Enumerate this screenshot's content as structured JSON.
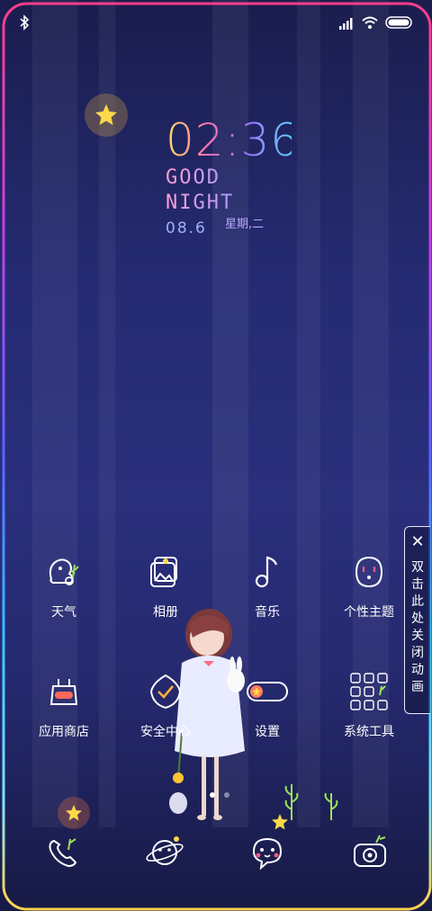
{
  "status": {
    "bluetooth_icon": "bluetooth-icon",
    "signal_icon": "signal-icon",
    "wifi_icon": "wifi-icon",
    "battery_icon": "battery-icon"
  },
  "clock": {
    "time": "02:36",
    "greeting": "GOOD NIGHT",
    "date": "08.6",
    "weekday": "星期,二"
  },
  "apps": [
    {
      "label": "天气",
      "icon": "weather-icon"
    },
    {
      "label": "相册",
      "icon": "gallery-icon"
    },
    {
      "label": "音乐",
      "icon": "music-icon"
    },
    {
      "label": "个性主题",
      "icon": "themes-icon"
    },
    {
      "label": "应用商店",
      "icon": "app-store-icon"
    },
    {
      "label": "安全中心",
      "icon": "security-icon"
    },
    {
      "label": "设置",
      "icon": "settings-toggle-icon"
    },
    {
      "label": "系统工具",
      "icon": "system-tools-icon"
    }
  ],
  "pager": {
    "pages": 2,
    "current": 1
  },
  "dock": [
    {
      "icon": "phone-icon"
    },
    {
      "icon": "planet-browser-icon"
    },
    {
      "icon": "message-bubble-icon"
    },
    {
      "icon": "camera-icon"
    }
  ],
  "close_animation": {
    "close_symbol": "✕",
    "text": "双击此处关闭动画"
  },
  "colors": {
    "background": "#252b72",
    "frame_top": "#ff3d8b",
    "frame_bottom": "#ffd34d",
    "date": "#9fb0ff"
  }
}
